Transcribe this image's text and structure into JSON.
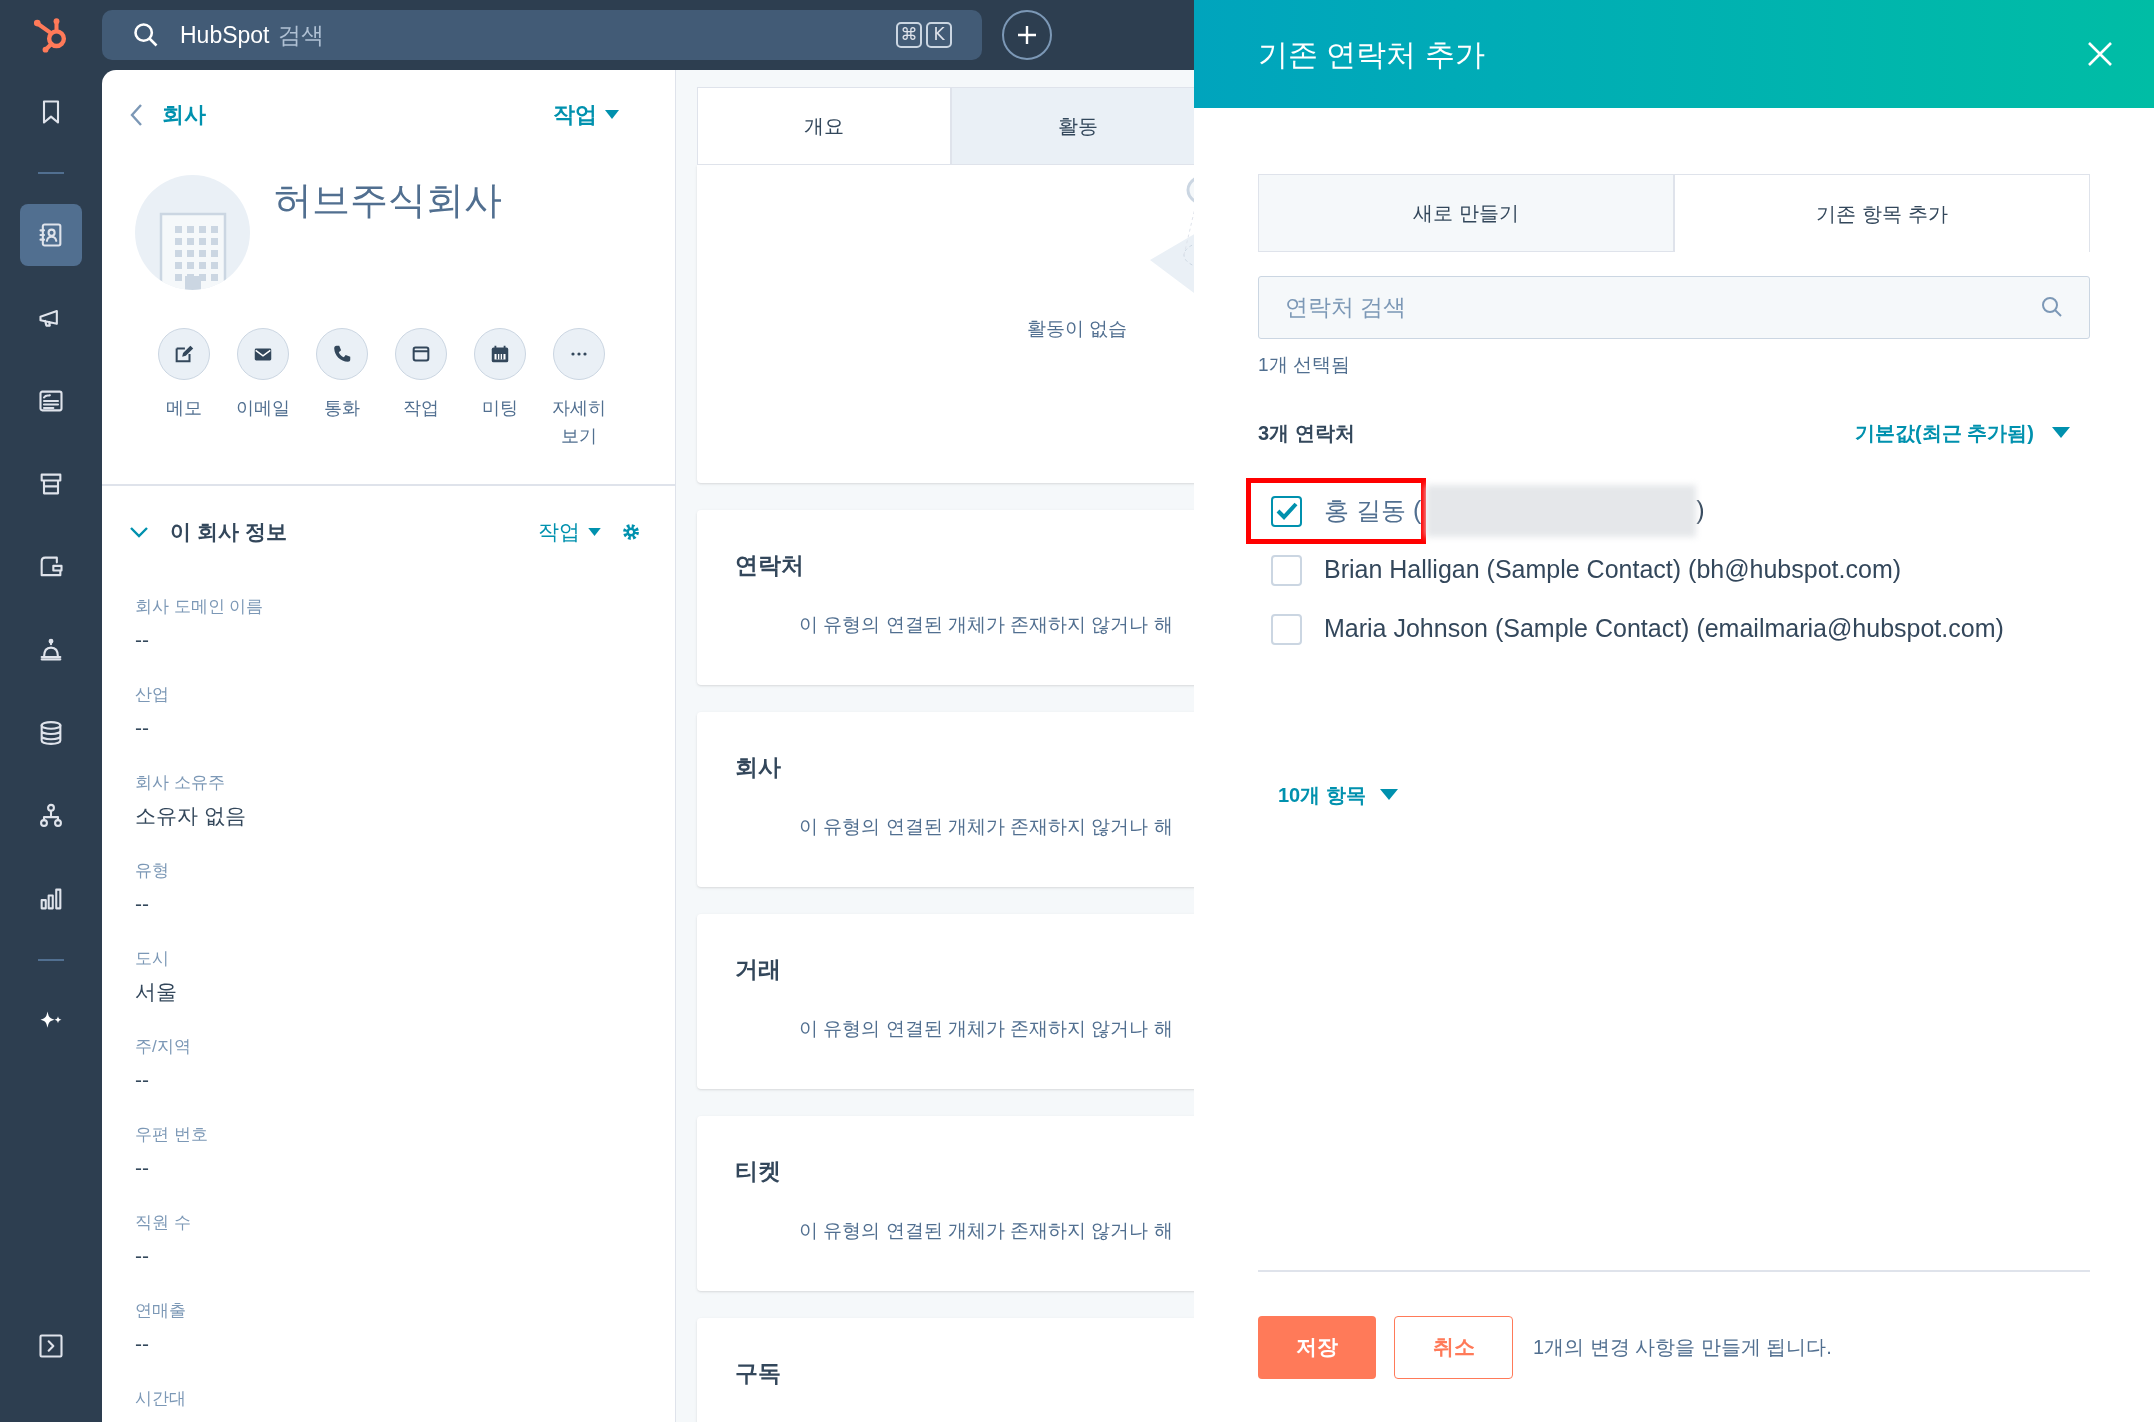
{
  "sidebar": {
    "items": [
      {
        "selected": false
      },
      {
        "selected": true
      },
      {
        "selected": false
      },
      {
        "selected": false
      },
      {
        "selected": false
      },
      {
        "selected": false
      },
      {
        "selected": false
      },
      {
        "selected": false
      },
      {
        "selected": false
      },
      {
        "selected": false
      },
      {
        "selected": false
      }
    ]
  },
  "search": {
    "brand": "HubSpot",
    "placeholder": "검색",
    "shortcut_keys": [
      "⌘",
      "K"
    ]
  },
  "company": {
    "back_label": "회사",
    "actions_label": "작업",
    "name": "허브주식회사",
    "quick_actions": [
      "메모",
      "이메일",
      "통화",
      "작업",
      "미팅",
      "자세히 보기"
    ]
  },
  "about": {
    "title": "이 회사 정보",
    "expanded": true,
    "actions_label": "작업",
    "fields": [
      {
        "label": "회사 도메인 이름",
        "value": "--"
      },
      {
        "label": "산업",
        "value": "--"
      },
      {
        "label": "회사 소유주",
        "value": "소유자 없음"
      },
      {
        "label": "유형",
        "value": "--"
      },
      {
        "label": "도시",
        "value": "서울"
      },
      {
        "label": "주/지역",
        "value": "--"
      },
      {
        "label": "우편 번호",
        "value": "--"
      },
      {
        "label": "직원 수",
        "value": "--"
      },
      {
        "label": "연매출",
        "value": "--"
      },
      {
        "label": "시간대"
      }
    ]
  },
  "middle": {
    "tabs": [
      {
        "label": "개요",
        "selected": true
      },
      {
        "label": "활동",
        "selected": false
      }
    ],
    "activity_empty": "활동이 없습",
    "cards": [
      {
        "title": "연락처",
        "message": "이 유형의 연결된 개체가 존재하지 않거나 해"
      },
      {
        "title": "회사",
        "message": "이 유형의 연결된 개체가 존재하지 않거나 해"
      },
      {
        "title": "거래",
        "message": "이 유형의 연결된 개체가 존재하지 않거나 해"
      },
      {
        "title": "티켓",
        "message": "이 유형의 연결된 개체가 존재하지 않거나 해"
      },
      {
        "title": "구독"
      }
    ]
  },
  "drawer": {
    "title": "기존 연락처 추가",
    "tabs": [
      {
        "label": "새로 만들기",
        "selected": false
      },
      {
        "label": "기존 항목 추가",
        "selected": true
      }
    ],
    "search_placeholder": "연락처 검색",
    "selected_count": "1개 선택됨",
    "list_title": "3개 연락처",
    "sort_label": "기본값(최근 추가됨)",
    "contacts": [
      {
        "label": "홍 길동 (",
        "suffix": ")",
        "checked": true,
        "redacted": true,
        "highlighted": true
      },
      {
        "label": "Brian Halligan (Sample Contact) (bh@hubspot.com)",
        "checked": false,
        "redacted": false,
        "highlighted": false
      },
      {
        "label": "Maria Johnson (Sample Contact) (emailmaria@hubspot.com)",
        "checked": false,
        "redacted": false,
        "highlighted": false
      }
    ],
    "more_label": "10개 항목",
    "save_label": "저장",
    "cancel_label": "취소",
    "note": "1개의 변경 사항을 만들게 됩니다."
  }
}
